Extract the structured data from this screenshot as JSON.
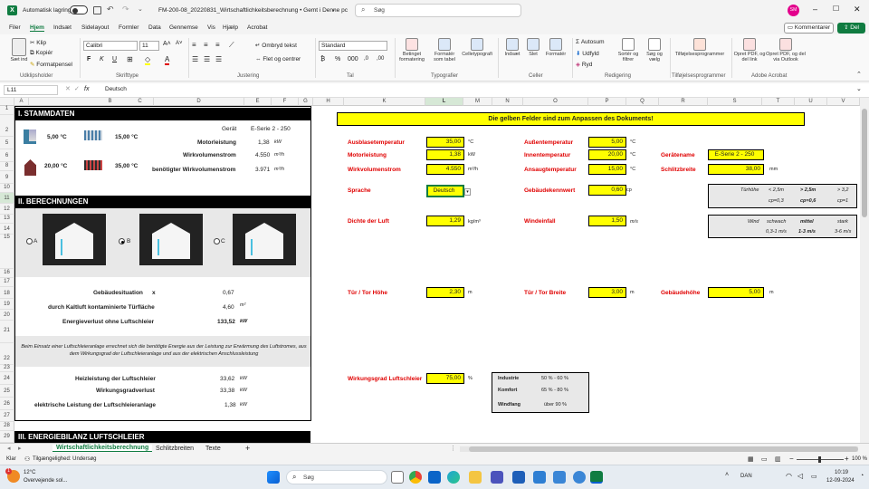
{
  "titlebar": {
    "autosave_label": "Automatisk lagring",
    "doc_title": "FM-200-08_20220831_Wirtschaftlichkeitsberechnung • Gemt i Denne pc",
    "search_placeholder": "Søg",
    "avatar_initials": "SM"
  },
  "menu": {
    "items": [
      "Filer",
      "Hjem",
      "Indsæt",
      "Sidelayout",
      "Formler",
      "Data",
      "Gennemse",
      "Vis",
      "Hjælp",
      "Acrobat"
    ],
    "comments_label": "Kommentarer",
    "share_label": "Del"
  },
  "ribbon": {
    "paste_label": "Sæt ind",
    "cut_label": "Klip",
    "copy_label": "Kopiér",
    "format_painter_label": "Formatpensel",
    "clipboard_group": "Udklipsholder",
    "font_name": "Calibri",
    "font_size": "11",
    "bold": "F",
    "italic": "K",
    "underline": "U",
    "font_group": "Skrifttype",
    "wrap_text": "Ombryd tekst",
    "merge_center": "Flet og centrer",
    "alignment_group": "Justering",
    "number_format": "Standard",
    "number_group": "Tal",
    "cond_format": "Betinget formatering",
    "format_table": "Formatér som tabel",
    "cell_styles": "Celletypografi",
    "styles_group": "Typografier",
    "insert": "Indsæt",
    "delete": "Slet",
    "format": "Formatér",
    "cells_group": "Celler",
    "autosum": "Autosum",
    "fill": "Udfyld",
    "clear": "Ryd",
    "sort_filter": "Sortér og filtrer",
    "find_select": "Søg og vælg",
    "editing_group": "Redigering",
    "sensitivity": "Tilføjelsesprogrammer",
    "addins_group": "Tilføjelsesprogrammer",
    "pdf_link": "Opret PDF, og del link",
    "pdf_outlook": "Opret PDF, og del via Outlook",
    "acrobat_group": "Adobe Acrobat"
  },
  "formula": {
    "name_box": "L11",
    "fx": "fx",
    "content": "Deutsch"
  },
  "columns": [
    "A",
    "B",
    "C",
    "D",
    "E",
    "F",
    "G",
    "H",
    "K",
    "L",
    "M",
    "N",
    "O",
    "P",
    "Q",
    "R",
    "S",
    "T",
    "U",
    "V"
  ],
  "rows": [
    "1",
    "2",
    "5",
    "6",
    "8",
    "9",
    "10",
    "11",
    "12",
    "13",
    "14",
    "15",
    "16",
    "17",
    "18",
    "19",
    "20",
    "21",
    "22",
    "23",
    "24",
    "25",
    "26",
    "27",
    "28",
    "29"
  ],
  "sheet": {
    "s1_title": "I. STAMMDATEN",
    "geraet_label": "Gerät",
    "geraet_value": "E-Serie 2 - 250",
    "temp1": "5,00 °C",
    "temp2": "15,00 °C",
    "temp3": "20,00 °C",
    "temp4": "35,00 °C",
    "motorleistung_label": "Motorleistung",
    "motorleistung_value": "1,38",
    "motorleistung_unit": "kW",
    "wirkvol_label": "Wirkvolumenstrom",
    "wirkvol_value": "4.550",
    "wirkvol_unit": "m³/h",
    "benwirkvol_label": "benötigter Wirkvolumenstrom",
    "benwirkvol_value": "3.971",
    "benwirkvol_unit": "m³/h",
    "s2_title": "II. BERECHNUNGEN",
    "radio_a": "A",
    "radio_b": "B",
    "radio_c": "C",
    "gebaeudesit_label": "Gebäudesituation",
    "gebaeudesit_x": "x",
    "gebaeudesit_value": "0,67",
    "kaltluft_label": "durch Kaltluft kontaminierte Türfläche",
    "kaltluft_value": "4,60",
    "kaltluft_unit": "m²",
    "energieverlust_label": "Energieverlust ohne Luftschleier",
    "energieverlust_value": "133,52",
    "energieverlust_unit": "kW",
    "note": "Beim Einsatz einer Luftschleieranlage errechnet sich die benötigte Energie aus der Leistung zur Erwärmung des Luftstromes, aus dem Wirkungsgrad der Luftschleieranlage und aus der elektrischen Anschlussleistung",
    "heizleistung_label": "Heizleistung der Luftschleier",
    "heizleistung_value": "33,62",
    "heizleistung_unit": "kW",
    "wirkungsgradverlust_label": "Wirkungsgradverlust",
    "wirkungsgradverlust_value": "33,38",
    "wirkungsgradverlust_unit": "kW",
    "elektr_label": "elektrische Leistung der Luftschleieranlage",
    "elektr_value": "1,38",
    "elektr_unit": "kW",
    "s3_title": "III. ENERGIEBILANZ LUFTSCHLEIER",
    "banner": "Die gelben Felder sind zum Anpassen des Dokuments!",
    "ausblase_label": "Ausblasetemperatur",
    "ausblase_value": "35,00",
    "ausblase_unit": "°C",
    "aussen_label": "Außentemperatur",
    "aussen_value": "5,00",
    "aussen_unit": "°C",
    "motor2_label": "Motorleistung",
    "motor2_value": "1,38",
    "motor2_unit": "kW",
    "innen_label": "Innentemperatur",
    "innen_value": "20,00",
    "innen_unit": "°C",
    "geraetename_label": "Gerätename",
    "geraetename_value": "E-Serie 2 - 250",
    "wirkvol2_label": "Wirkvolumenstrom",
    "wirkvol2_value": "4.550",
    "wirkvol2_unit": "m³/h",
    "ansaug_label": "Ansaugtemperatur",
    "ansaug_value": "15,00",
    "ansaug_unit": "°C",
    "schlitz_label": "Schlitzbreite",
    "schlitz_value": "38,00",
    "schlitz_unit": "mm",
    "sprache_label": "Sprache",
    "sprache_value": "Deutsch",
    "gebkenn_label": "Gebäudekennwert",
    "gebkenn_value": "0,60",
    "gebkenn_unit": "cp",
    "tuerhoehe_label": "Türhöhe",
    "tuerhoehe_a": "< 2,5m",
    "tuerhoehe_b": "> 2,5m",
    "tuerhoehe_c": "> 3,2",
    "cp_a": "cp=0,3",
    "cp_b": "cp=0,6",
    "cp_c": "cp=1",
    "dichte_label": "Dichte der Luft",
    "dichte_value": "1,29",
    "dichte_unit": "kg/m³",
    "wind_label": "Windeinfall",
    "wind_value": "1,50",
    "wind_unit": "m/s",
    "wind_hdr": "Wind",
    "wind_a": "schwach",
    "wind_b": "mittel",
    "wind_c": "stark",
    "wind_a2": "0,3-1 m/s",
    "wind_b2": "1-3 m/s",
    "wind_c2": "3-6 m/s",
    "tuerhoeh_label": "Tür / Tor Höhe",
    "tuerhoeh_value": "2,30",
    "tuerhoeh_unit": "m",
    "tuerbreite_label": "Tür / Tor Breite",
    "tuerbreite_value": "3,00",
    "tuerbreite_unit": "m",
    "gebhoehe_label": "Gebäudehöhe",
    "gebhoehe_value": "5,00",
    "gebhoehe_unit": "m",
    "wirkgrad_label": "Wirkungsgrad Luftschleier",
    "wirkgrad_value": "75,00",
    "wirkgrad_unit": "%",
    "ind_label": "Industrie",
    "ind_value": "50 % - 60 %",
    "komf_label": "Komfort",
    "komf_value": "65 % - 80 %",
    "windf_label": "Windfang",
    "windf_value": "über 90 %"
  },
  "tabs": [
    "Wirtschaftlichkeitsberechnung",
    "Schlitzbreiten",
    "Texte"
  ],
  "status": {
    "ready": "Klar",
    "accessibility": "Tilgængelighed: Undersøg",
    "zoom": "100 %"
  },
  "taskbar": {
    "weather_temp": "12°C",
    "weather_text": "Overvejende sol...",
    "search": "Søg",
    "lang": "DAN",
    "time": "10:19",
    "date": "12-09-2024"
  },
  "colors": {
    "excel_green": "#107c41",
    "yellow": "#ffff00",
    "red_label": "#e00000"
  }
}
